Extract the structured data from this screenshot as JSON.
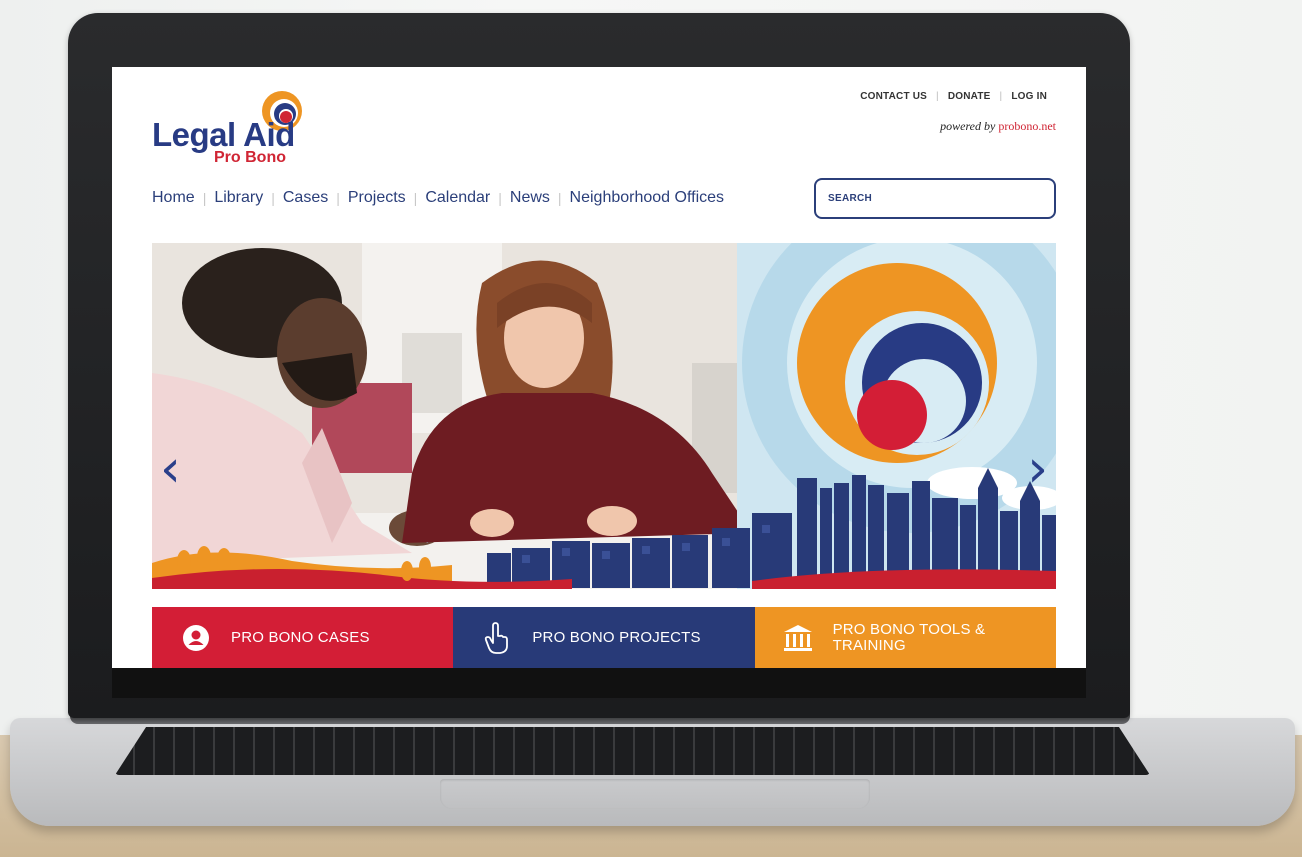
{
  "logo": {
    "title": "Legal Aid",
    "subtitle": "Pro Bono"
  },
  "top_links": {
    "contact": "CONTACT US",
    "donate": "DONATE",
    "login": "LOG IN"
  },
  "powered_by": {
    "prefix": "powered by",
    "brand": "probono.net"
  },
  "nav": {
    "items": [
      "Home",
      "Library",
      "Cases",
      "Projects",
      "Calendar",
      "News",
      "Neighborhood Offices"
    ]
  },
  "search": {
    "placeholder": "SEARCH"
  },
  "hero": {
    "prev_icon": "chevron-left-icon",
    "next_icon": "chevron-right-icon"
  },
  "cta": [
    {
      "label": "PRO BONO CASES",
      "icon": "person-icon",
      "color": "#d31e36"
    },
    {
      "label": "PRO BONO PROJECTS",
      "icon": "pointer-hand-icon",
      "color": "#283a78"
    },
    {
      "label": "PRO BONO TOOLS & TRAINING",
      "icon": "courthouse-icon",
      "color": "#ee9523"
    }
  ],
  "colors": {
    "brand_blue": "#283b84",
    "brand_red": "#d02534",
    "brand_orange": "#ee9523"
  }
}
